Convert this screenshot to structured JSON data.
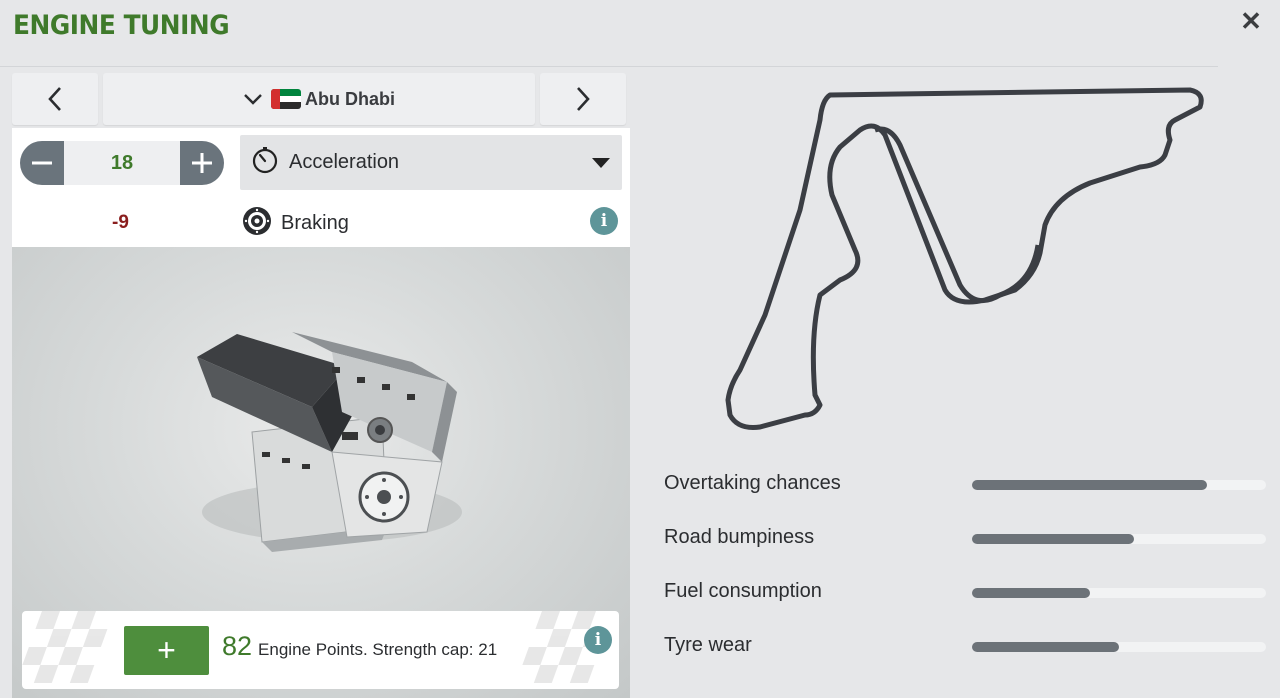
{
  "header": {
    "title": "ENGINE TUNING",
    "close_icon": "close-icon"
  },
  "nav": {
    "track_name": "Abu Dhabi",
    "flag": "uae-flag-icon",
    "prev_icon": "chevron-left-icon",
    "next_icon": "chevron-right-icon",
    "expand_icon": "chevron-down-icon"
  },
  "tuning": {
    "value": "18",
    "minus_icon": "minus-icon",
    "plus_icon": "plus-icon",
    "selected_stat": "Acceleration",
    "selected_stat_icon": "stopwatch-icon",
    "opposite_value": "-9",
    "opposite_stat": "Braking",
    "opposite_stat_icon": "brake-disc-icon",
    "info_glyph": "i"
  },
  "points": {
    "add_glyph": "+",
    "amount": "82",
    "description": "Engine Points. Strength cap: 21",
    "info_glyph": "i"
  },
  "stats": [
    {
      "label": "Overtaking chances",
      "level": 0.8
    },
    {
      "label": "Road bumpiness",
      "level": 0.55
    },
    {
      "label": "Fuel consumption",
      "level": 0.4
    },
    {
      "label": "Tyre wear",
      "level": 0.5
    }
  ],
  "colors": {
    "accent_green": "#3f7a2b",
    "button_green": "#4e8e3d",
    "negative_red": "#8a1e1e",
    "info_teal": "#5e9599",
    "bar_fill": "#6c7278"
  }
}
